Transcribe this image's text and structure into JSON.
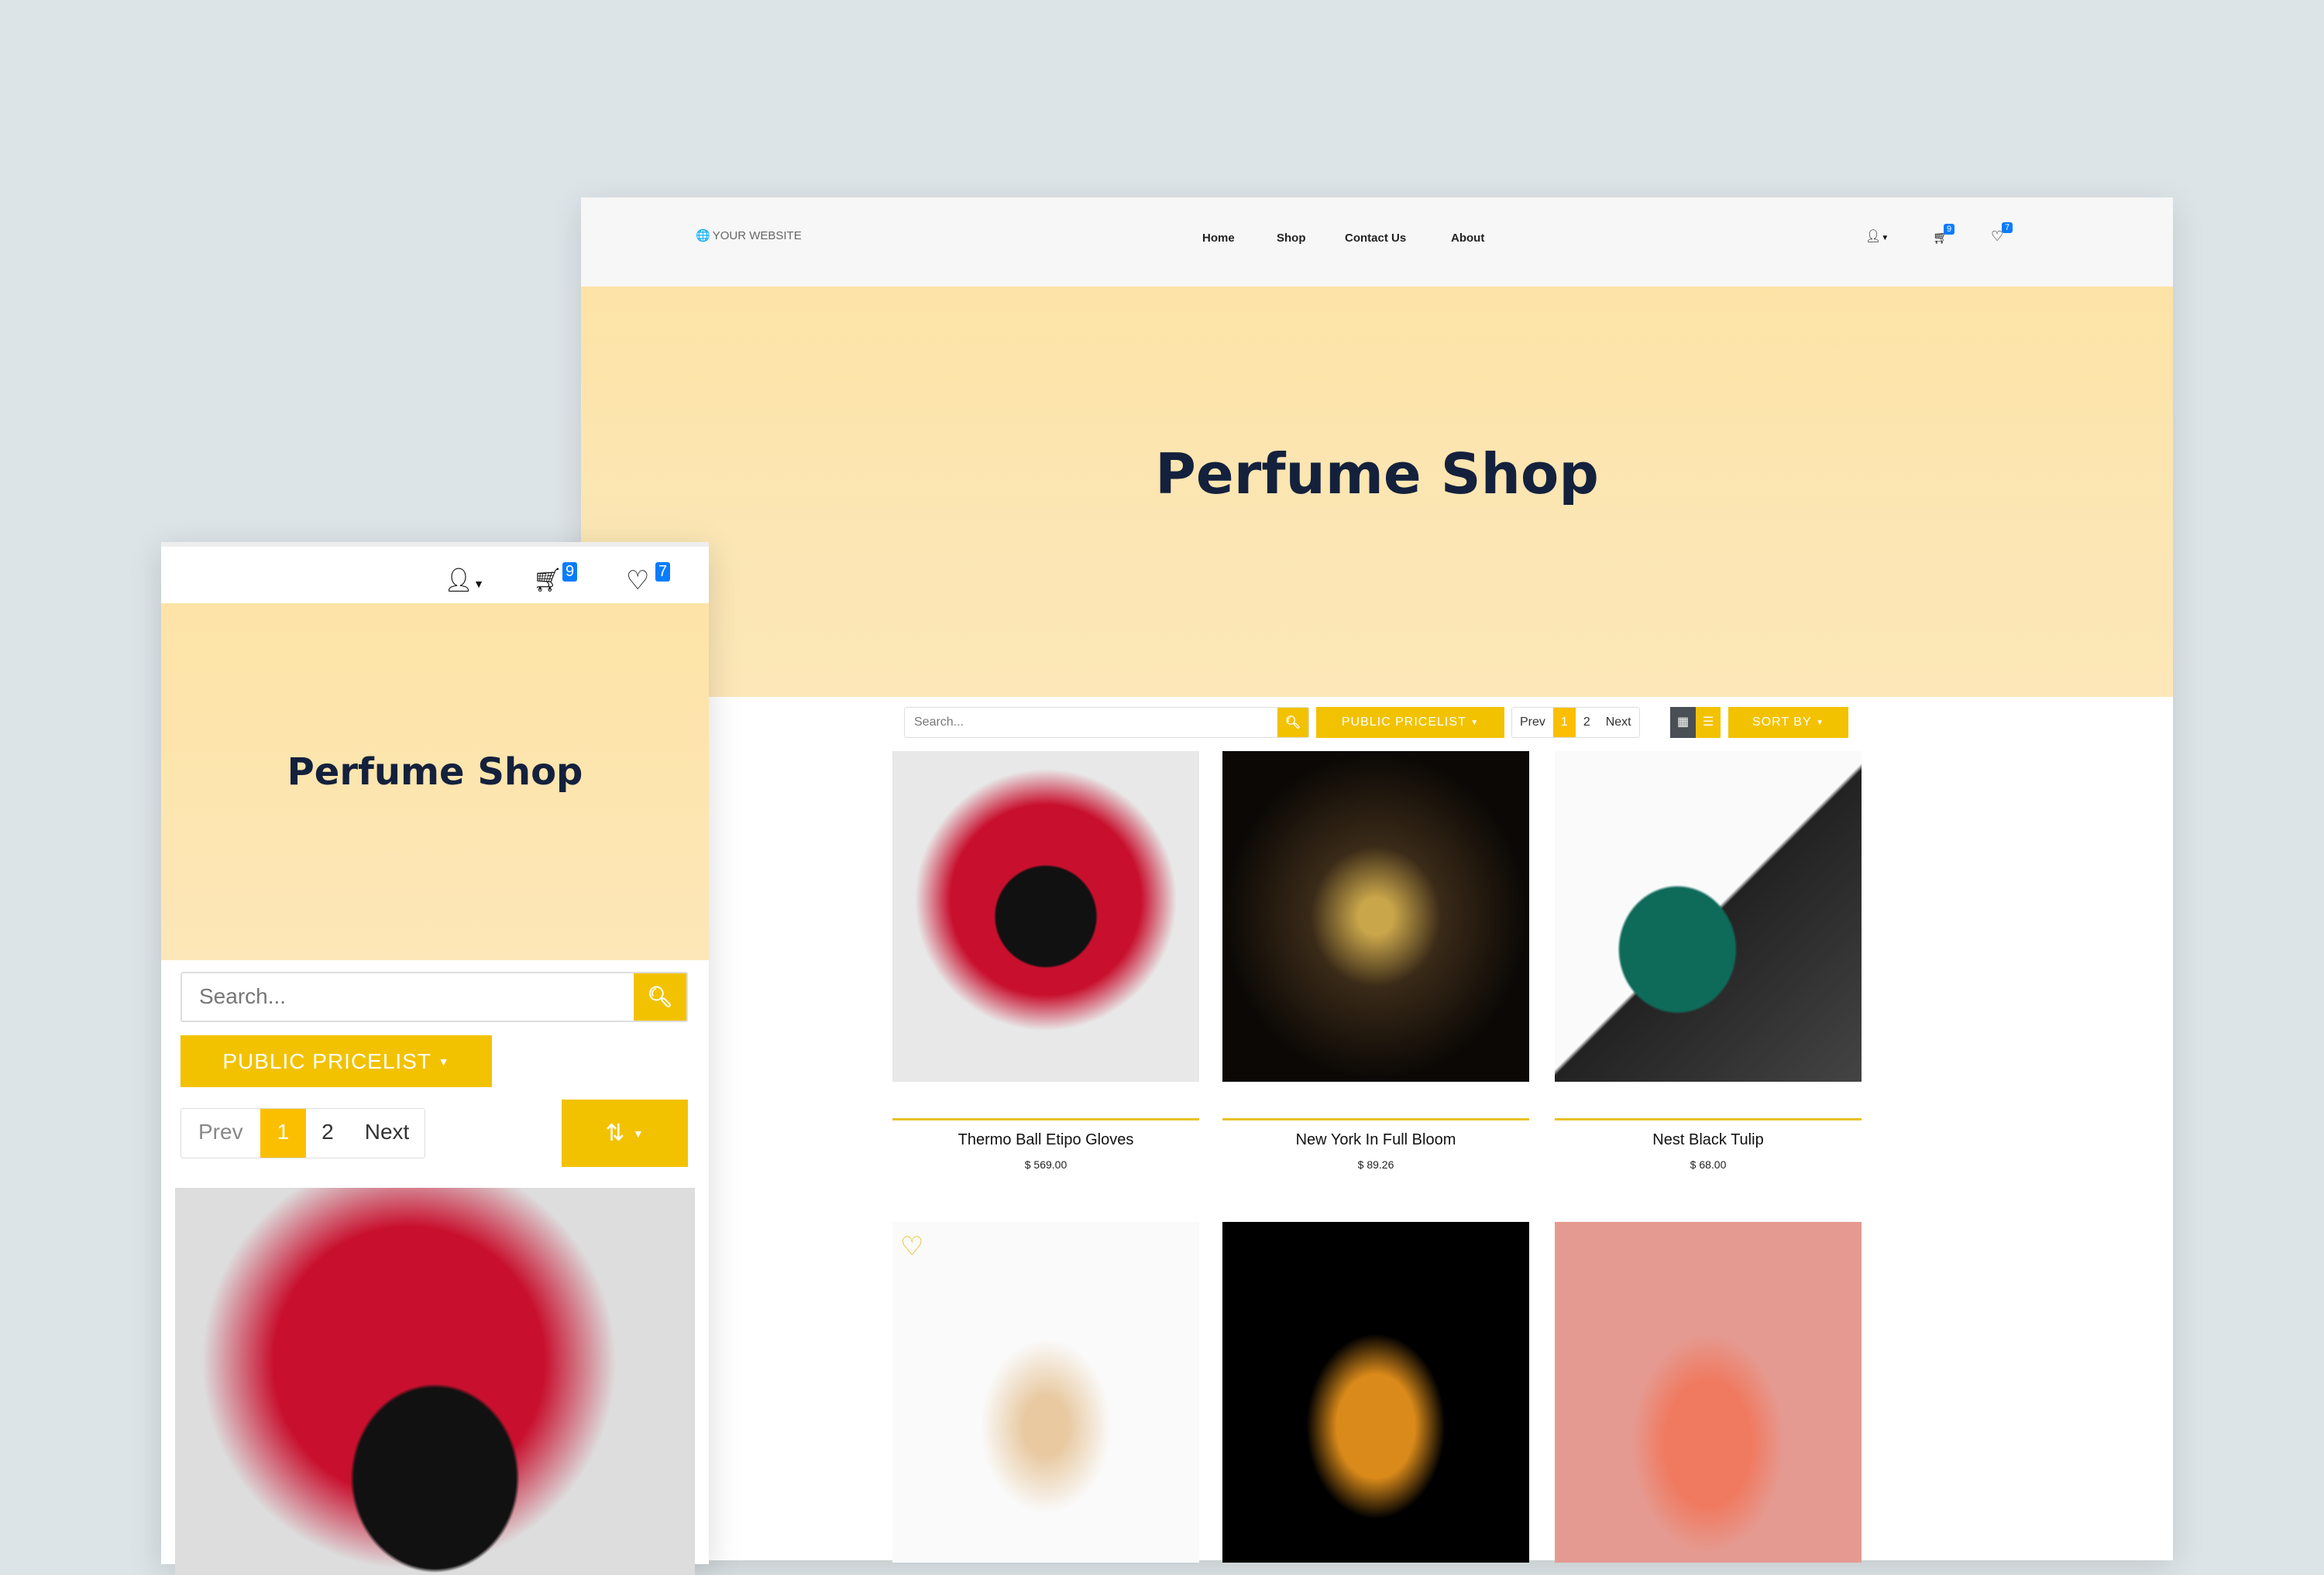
{
  "desktop": {
    "logo": "YOUR WEBSITE",
    "nav": [
      {
        "label": "Home"
      },
      {
        "label": "Shop"
      },
      {
        "label": "Contact Us"
      },
      {
        "label": "About"
      }
    ],
    "cart_count": "9",
    "wishlist_count": "7",
    "hero_title": "Perfume Shop",
    "search_placeholder": "Search...",
    "pricelist_label": "PUBLIC PRICELIST",
    "pager": {
      "prev": "Prev",
      "pages": [
        "1",
        "2"
      ],
      "next": "Next",
      "current": "1"
    },
    "sort_label": "SORT BY",
    "products": [
      {
        "name": "Thermo Ball Etipo Gloves",
        "price": "$ 569.00"
      },
      {
        "name": "New York In Full Bloom",
        "price": "$ 89.26"
      },
      {
        "name": "Nest Black Tulip",
        "price": "$ 68.00"
      }
    ]
  },
  "mobile": {
    "cart_count": "9",
    "wishlist_count": "7",
    "hero_title": "Perfume Shop",
    "search_placeholder": "Search...",
    "pricelist_label": "PUBLIC PRICELIST",
    "pager": {
      "prev": "Prev",
      "pages": [
        "1",
        "2"
      ],
      "next": "Next"
    }
  },
  "colors": {
    "accent": "#f2c200",
    "badge": "#0a7cff",
    "title": "#14213d"
  }
}
